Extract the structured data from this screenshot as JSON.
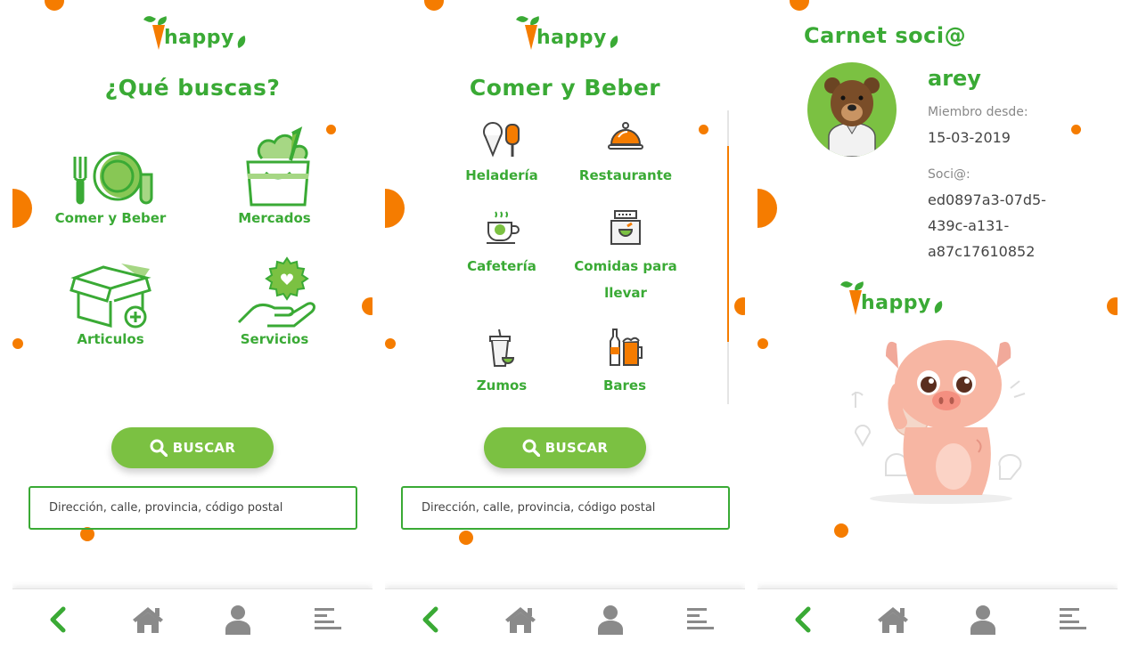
{
  "brand": {
    "logo_text": "happy"
  },
  "screen1": {
    "title": "¿Qué buscas?",
    "categories": [
      {
        "label": "Comer y Beber",
        "icon": "plate-cutlery-icon"
      },
      {
        "label": "Mercados",
        "icon": "grocery-bag-icon"
      },
      {
        "label": "Articulos",
        "icon": "box-add-icon"
      },
      {
        "label": "Servicios",
        "icon": "hand-gear-icon"
      }
    ],
    "search_label": "BUSCAR",
    "address_placeholder": "Dirección, calle, provincia, código postal"
  },
  "screen2": {
    "title": "Comer y Beber",
    "categories": [
      {
        "label": "Heladería",
        "icon": "ice-cream-icon"
      },
      {
        "label": "Restaurante",
        "icon": "cloche-icon"
      },
      {
        "label": "Cafetería",
        "icon": "coffee-cup-icon"
      },
      {
        "label_line1": "Comidas para",
        "label_line2": "llevar",
        "icon": "takeaway-icon"
      },
      {
        "label": "Zumos",
        "icon": "juice-icon"
      },
      {
        "label": "Bares",
        "icon": "beer-bottle-icon"
      }
    ],
    "search_label": "BUSCAR",
    "address_placeholder": "Dirección, calle, provincia, código postal"
  },
  "screen3": {
    "title": "Carnet soci@",
    "username": "arey",
    "member_since_label": "Miembro desde:",
    "member_since_value": "15-03-2019",
    "member_id_label": "Soci@:",
    "member_id_line1": "ed0897a3-07d5-",
    "member_id_line2": "439c-a131-",
    "member_id_line3": "a87c17610852"
  },
  "navbar": {
    "items": [
      {
        "icon": "back-chevron-icon"
      },
      {
        "icon": "home-icon"
      },
      {
        "icon": "user-icon"
      },
      {
        "icon": "menu-icon"
      }
    ]
  },
  "colors": {
    "green": "#3aaa35",
    "light_green": "#7bc142",
    "orange": "#f57c00",
    "grey_icon": "#8a8a8a"
  }
}
